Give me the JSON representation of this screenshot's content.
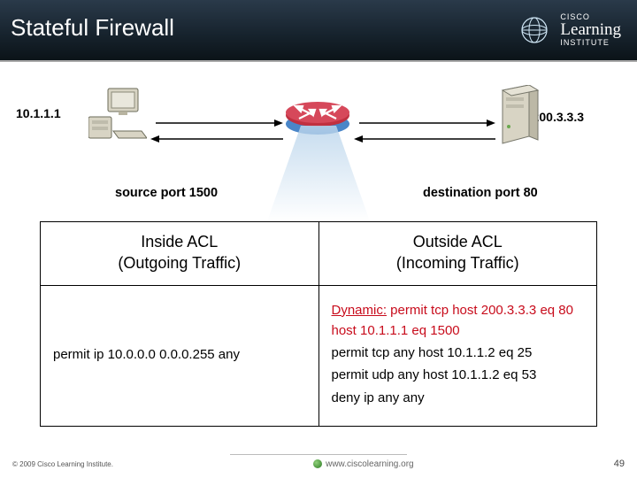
{
  "header": {
    "title": "Stateful Firewall",
    "brand_small": "CISCO",
    "brand_line1": "Learning",
    "brand_line2": "INSTITUTE"
  },
  "diagram": {
    "ip_left": "10.1.1.1",
    "ip_right": "200.3.3.3",
    "port_left": "source port 1500",
    "port_right": "destination port 80"
  },
  "acl": {
    "inside_header_l1": "Inside ACL",
    "inside_header_l2": "(Outgoing Traffic)",
    "outside_header_l1": "Outside ACL",
    "outside_header_l2": "(Incoming Traffic)",
    "inside_rule": "permit ip 10.0.0.0 0.0.0.255 any",
    "outside_rules": {
      "dynamic_label": "Dynamic:",
      "dynamic_text": " permit tcp host 200.3.3.3 eq 80 host 10.1.1.1 eq 1500",
      "r2": "permit tcp any host 10.1.1.2 eq 25",
      "r3": "permit udp any host 10.1.1.2 eq 53",
      "r4": "deny ip any any"
    }
  },
  "footer": {
    "copyright": "© 2009 Cisco Learning Institute.",
    "url": "www.ciscolearning.org",
    "page_number": "49"
  }
}
